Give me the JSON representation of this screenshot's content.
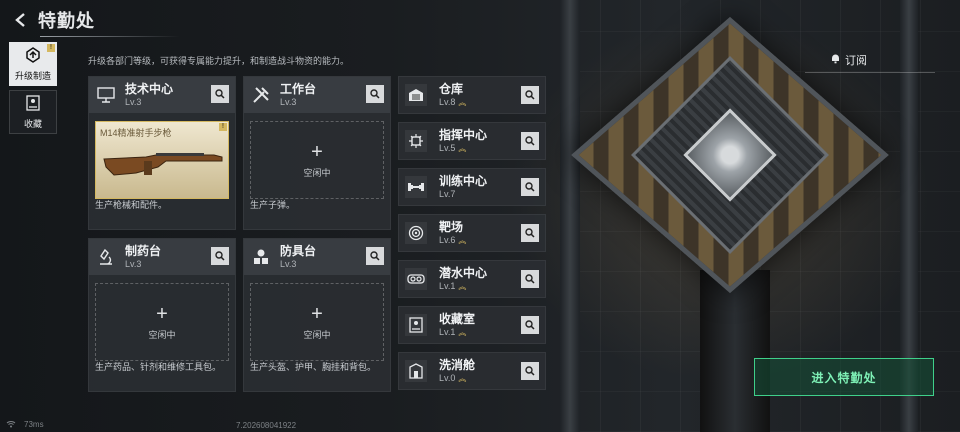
{
  "header": {
    "title": "特勤处",
    "back_icon": "back-arrow-icon"
  },
  "leftnav": {
    "items": [
      {
        "label": "升级制造",
        "icon": "upgrade-icon",
        "active": true,
        "badge": "!"
      },
      {
        "label": "收藏",
        "icon": "collection-icon",
        "active": false
      }
    ]
  },
  "description": "升级各部门等级，可获得专属能力提升，和制造战斗物资的能力。",
  "departments": [
    {
      "name": "技术中心",
      "level": "Lv.3",
      "icon": "monitor-icon",
      "slot_item": "M14精准射手步枪",
      "badge": "!",
      "footer": "生产枪械和配件。"
    },
    {
      "name": "工作台",
      "level": "Lv.3",
      "icon": "tools-icon",
      "slot_idle": "空闲中",
      "footer": "生产子弹。"
    },
    {
      "name": "制药台",
      "level": "Lv.3",
      "icon": "microscope-icon",
      "slot_idle": "空闲中",
      "footer": "生产药品、针剂和维修工具包。"
    },
    {
      "name": "防具台",
      "level": "Lv.3",
      "icon": "armor-icon",
      "slot_idle": "空闲中",
      "footer": "生产头盔、护甲、胸挂和背包。"
    }
  ],
  "facilities": [
    {
      "name": "仓库",
      "level": "Lv.8",
      "icon": "warehouse-icon",
      "upgradable": true
    },
    {
      "name": "指挥中心",
      "level": "Lv.5",
      "icon": "command-chip-icon",
      "upgradable": true
    },
    {
      "name": "训练中心",
      "level": "Lv.7",
      "icon": "dumbbell-icon",
      "upgradable": false
    },
    {
      "name": "靶场",
      "level": "Lv.6",
      "icon": "target-icon",
      "upgradable": true
    },
    {
      "name": "潜水中心",
      "level": "Lv.1",
      "icon": "diving-icon",
      "upgradable": true
    },
    {
      "name": "收藏室",
      "level": "Lv.1",
      "icon": "collection-room-icon",
      "upgradable": true
    },
    {
      "name": "洗消舱",
      "level": "Lv.0",
      "icon": "decon-icon",
      "upgradable": true
    }
  ],
  "idle_plus": "+",
  "subscribe": {
    "label": "订阅",
    "icon": "bell-icon"
  },
  "enter_button": "进入特勤处",
  "status": {
    "ping": "73ms",
    "build": "7.202608041922"
  },
  "colors": {
    "accent_green": "#3fd08a",
    "badge_gold": "#d4b860"
  }
}
